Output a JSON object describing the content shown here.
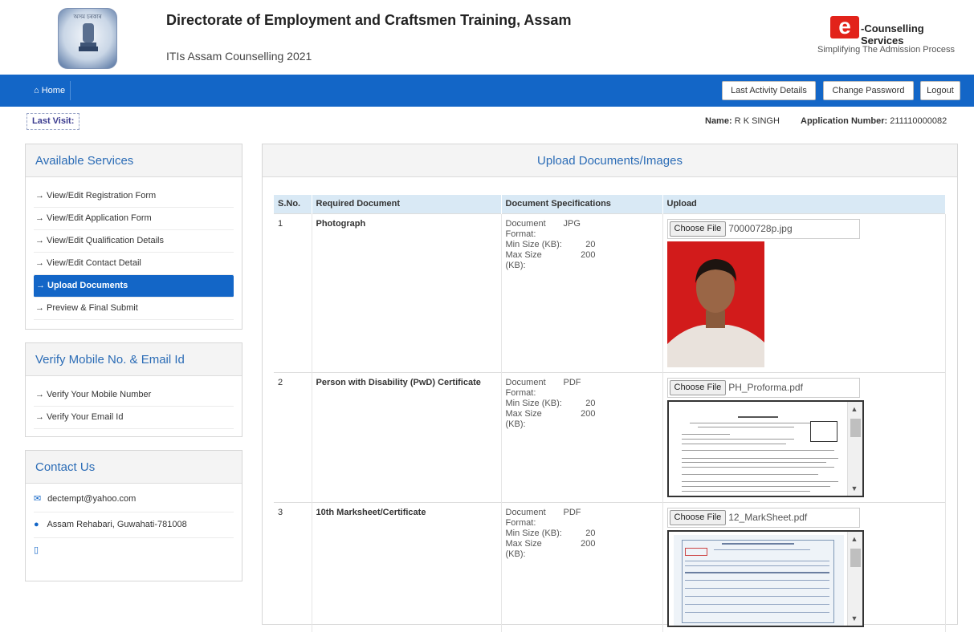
{
  "header": {
    "emblem_text": "অসম চৰকাৰ",
    "title": "Directorate of Employment and Craftsmen Training, Assam",
    "subtitle": "ITIs Assam Counselling 2021",
    "brand_mark": "e",
    "brand_label": "-Counselling Services",
    "brand_tagline": "Simplifying The Admission Process"
  },
  "nav": {
    "home": "Home",
    "last_activity": "Last Activity Details",
    "change_password": "Change Password",
    "logout": "Logout"
  },
  "info": {
    "last_visit": "Last Visit:",
    "name_label": "Name:",
    "name_value": "R K SINGH",
    "app_label": "Application Number:",
    "app_value": "211110000082"
  },
  "services": {
    "title": "Available Services",
    "items": [
      "→ View/Edit Registration Form",
      "→ View/Edit Application Form",
      "→ View/Edit Qualification Details",
      "→ View/Edit Contact Detail",
      "→ Upload Documents",
      "→ Preview & Final Submit"
    ]
  },
  "verify": {
    "title": "Verify Mobile No. & Email Id",
    "items": [
      "→ Verify Your Mobile Number",
      "→ Verify Your Email Id"
    ]
  },
  "contact": {
    "title": "Contact Us",
    "email": "dectempt@yahoo.com",
    "address": "Assam Rehabari, Guwahati-781008",
    "phone": ""
  },
  "main": {
    "title": "Upload Documents/Images",
    "columns": [
      "S.No.",
      "Required Document",
      "Document Specifications",
      "Upload"
    ],
    "choose_label": "Choose File",
    "spec_labels": {
      "format": "Document Format:",
      "min": "Min Size (KB):",
      "max": "Max Size (KB):"
    },
    "rows": [
      {
        "sno": "1",
        "doc": "Photograph",
        "format": "JPG",
        "min": "20",
        "max": "200",
        "file": "70000728p.jpg"
      },
      {
        "sno": "2",
        "doc": "Person with Disability (PwD) Certificate",
        "format": "PDF",
        "min": "20",
        "max": "200",
        "file": "PH_Proforma.pdf"
      },
      {
        "sno": "3",
        "doc": "10th Marksheet/Certificate",
        "format": "PDF",
        "min": "20",
        "max": "200",
        "file": "12_MarkSheet.pdf"
      }
    ]
  },
  "colors": {
    "primary": "#1366c7",
    "panel_title": "#2b6cb6",
    "brand_red": "#e2231a"
  }
}
